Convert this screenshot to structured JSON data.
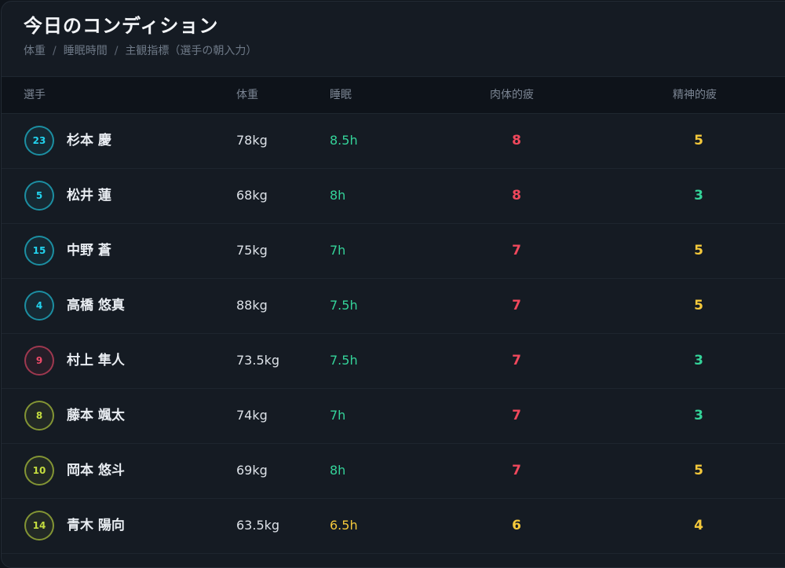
{
  "header": {
    "title": "今日のコンディション",
    "breadcrumb": [
      "体重",
      "睡眠時間",
      "主観指標（選手の朝入力）"
    ],
    "separator": "/"
  },
  "columns": {
    "player": "選手",
    "weight": "体重",
    "sleep": "睡眠",
    "physical": "肉体的疲",
    "mental": "精神的疲"
  },
  "colors": {
    "red": "#f0485c",
    "yellow": "#f5c93b",
    "green": "#34d399",
    "cyan": "#22d3ee",
    "pink": "#f04a6a",
    "lime": "#c4dd3f"
  },
  "players": [
    {
      "number": "23",
      "name": "杉本 慶",
      "weight": "78kg",
      "sleep": "8.5h",
      "physical": "8",
      "mental": "5",
      "badge": "cyan",
      "sleep_color": "green",
      "physical_color": "red",
      "mental_color": "yellow"
    },
    {
      "number": "5",
      "name": "松井 蓮",
      "weight": "68kg",
      "sleep": "8h",
      "physical": "8",
      "mental": "3",
      "badge": "cyan",
      "sleep_color": "green",
      "physical_color": "red",
      "mental_color": "green"
    },
    {
      "number": "15",
      "name": "中野 蒼",
      "weight": "75kg",
      "sleep": "7h",
      "physical": "7",
      "mental": "5",
      "badge": "cyan",
      "sleep_color": "green",
      "physical_color": "red",
      "mental_color": "yellow"
    },
    {
      "number": "4",
      "name": "高橋 悠真",
      "weight": "88kg",
      "sleep": "7.5h",
      "physical": "7",
      "mental": "5",
      "badge": "cyan",
      "sleep_color": "green",
      "physical_color": "red",
      "mental_color": "yellow"
    },
    {
      "number": "9",
      "name": "村上 隼人",
      "weight": "73.5kg",
      "sleep": "7.5h",
      "physical": "7",
      "mental": "3",
      "badge": "pink",
      "sleep_color": "green",
      "physical_color": "red",
      "mental_color": "green"
    },
    {
      "number": "8",
      "name": "藤本 颯太",
      "weight": "74kg",
      "sleep": "7h",
      "physical": "7",
      "mental": "3",
      "badge": "lime",
      "sleep_color": "green",
      "physical_color": "red",
      "mental_color": "green"
    },
    {
      "number": "10",
      "name": "岡本 悠斗",
      "weight": "69kg",
      "sleep": "8h",
      "physical": "7",
      "mental": "5",
      "badge": "lime",
      "sleep_color": "green",
      "physical_color": "red",
      "mental_color": "yellow"
    },
    {
      "number": "14",
      "name": "青木 陽向",
      "weight": "63.5kg",
      "sleep": "6.5h",
      "physical": "6",
      "mental": "4",
      "badge": "lime",
      "sleep_color": "yellow",
      "physical_color": "yellow",
      "mental_color": "yellow"
    }
  ]
}
